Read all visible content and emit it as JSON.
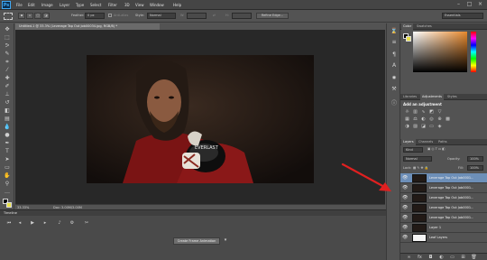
{
  "app": {
    "logo": "Ps",
    "menu": [
      "File",
      "Edit",
      "Image",
      "Layer",
      "Type",
      "Select",
      "Filter",
      "3D",
      "View",
      "Window",
      "Help"
    ]
  },
  "window_controls": [
    "minimize-icon",
    "maximize-icon",
    "close-icon"
  ],
  "options": {
    "feather_label": "Feather:",
    "feather_value": "0 px",
    "antialias_label": "Anti-alias",
    "style_label": "Style:",
    "style_value": "Normal",
    "width_label": "W:",
    "height_label": "H:",
    "refine_edge_label": "Refine Edge...",
    "workspace": "Essentials"
  },
  "document": {
    "tab_title": "Untitled-1 @ 33.3% (Leverage Tap Out Job00034.jpg, RGB/8) *",
    "zoom": "33.33%",
    "doc_size": "Doc: 3.00M/3.00M"
  },
  "timeline": {
    "title": "Timeline",
    "create_button": "Create Frame Animation"
  },
  "color_panel": {
    "tabs": [
      "Color",
      "Swatches"
    ],
    "fg_color": "#000000",
    "bg_color": "#e8e04a"
  },
  "adjustments_panel": {
    "tabs": [
      "Libraries",
      "Adjustments",
      "Styles"
    ],
    "title": "Add an adjustment"
  },
  "layers_panel": {
    "tabs": [
      "Layers",
      "Channels",
      "Paths"
    ],
    "kind_filter": "Kind",
    "blend_mode": "Normal",
    "opacity_label": "Opacity:",
    "opacity_value": "100%",
    "lock_label": "Lock:",
    "fill_label": "Fill:",
    "fill_value": "100%",
    "layers": [
      {
        "name": "Leverage Tap Out Job0001...",
        "selected": true,
        "white": false
      },
      {
        "name": "Leverage Tap Out Job0001...",
        "selected": false,
        "white": false
      },
      {
        "name": "Leverage Tap Out Job0001...",
        "selected": false,
        "white": false
      },
      {
        "name": "Leverage Tap Out Job0001...",
        "selected": false,
        "white": false
      },
      {
        "name": "Leverage Tap Out Job0001...",
        "selected": false,
        "white": false
      },
      {
        "name": "Layer 1",
        "selected": false,
        "white": false
      },
      {
        "name": "Leaf Layers",
        "selected": false,
        "white": true
      }
    ]
  },
  "accent": {
    "annotation_arrow": "#e02020",
    "selection": "#6d8fb8"
  }
}
